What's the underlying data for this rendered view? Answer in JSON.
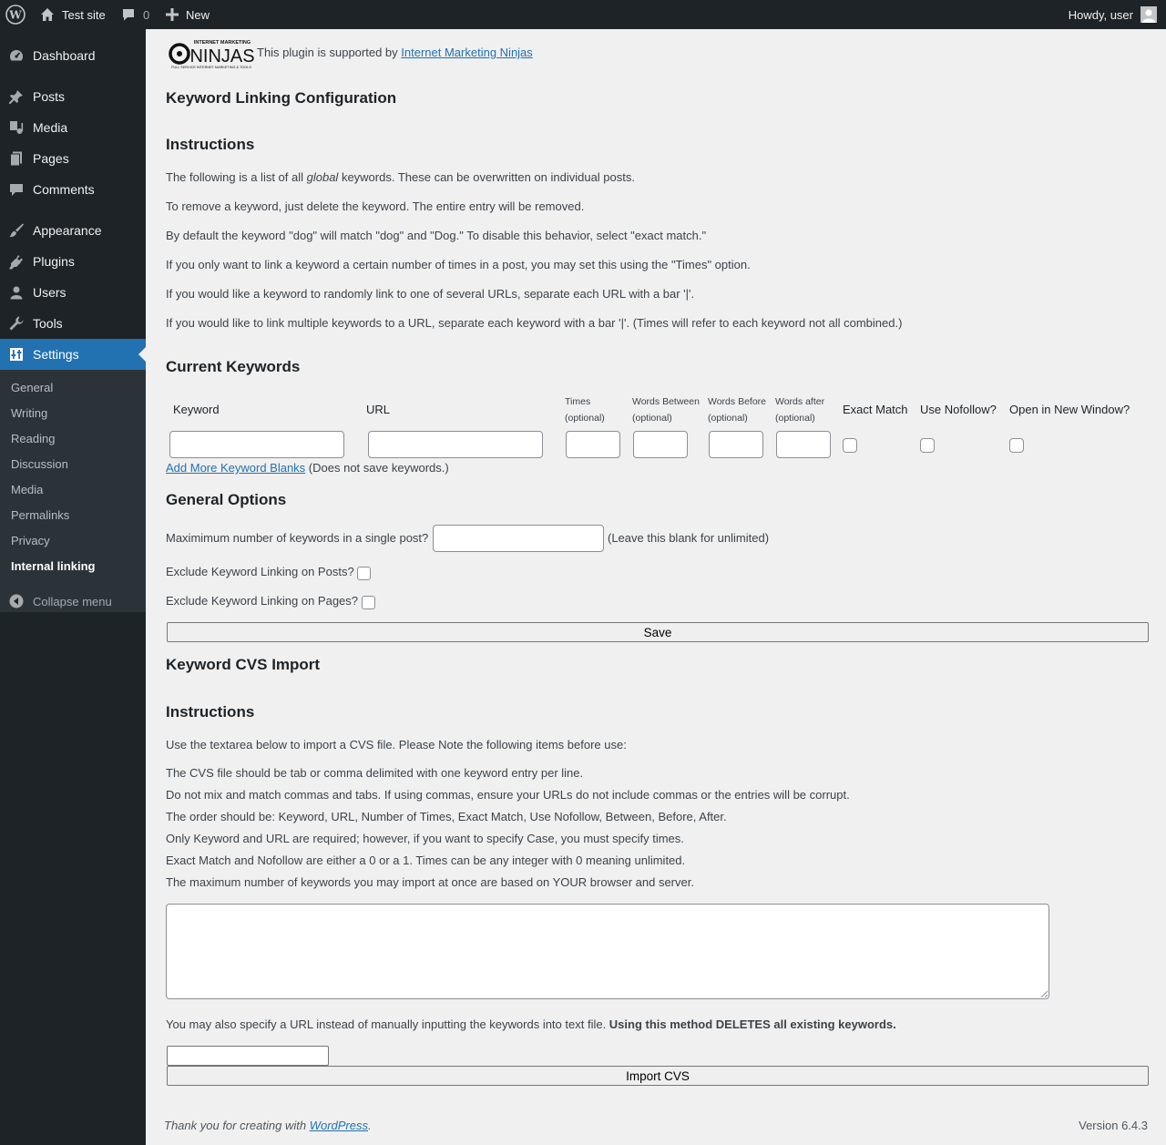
{
  "adminbar": {
    "site_name": "Test site",
    "comments_count": "0",
    "new_label": "New",
    "howdy": "Howdy, user"
  },
  "sidebar": {
    "items": [
      {
        "label": "Dashboard",
        "icon": "dashboard-icon"
      },
      {
        "label": "Posts",
        "icon": "pin-icon"
      },
      {
        "label": "Media",
        "icon": "media-icon"
      },
      {
        "label": "Pages",
        "icon": "pages-icon"
      },
      {
        "label": "Comments",
        "icon": "comments-icon"
      },
      {
        "label": "Appearance",
        "icon": "brush-icon"
      },
      {
        "label": "Plugins",
        "icon": "plug-icon"
      },
      {
        "label": "Users",
        "icon": "users-icon"
      },
      {
        "label": "Tools",
        "icon": "wrench-icon"
      },
      {
        "label": "Settings",
        "icon": "settings-icon"
      }
    ],
    "submenu": [
      "General",
      "Writing",
      "Reading",
      "Discussion",
      "Media",
      "Permalinks",
      "Privacy",
      "Internal linking"
    ],
    "collapse_label": "Collapse menu"
  },
  "sponsor": {
    "logo_top": "INTERNET MARKETING",
    "logo_main": "NINJAS",
    "logo_tag": "FULL SERVICE INTERNET MARKETING & TOOLS",
    "text": "This plugin is supported by",
    "link": "Internet Marketing Ninjas"
  },
  "page_title": "Keyword Linking Configuration",
  "instructions": {
    "heading": "Instructions",
    "line1_before": "The following is a list of all ",
    "line1_em": "global",
    "line1_after": " keywords. These can be overwritten on individual posts.",
    "lines": [
      "To remove a keyword, just delete the keyword. The entire entry will be removed.",
      "By default the keyword \"dog\" will match \"dog\" and \"Dog.\" To disable this behavior, select \"exact match.\"",
      "If you only want to link a keyword a certain number of times in a post, you may set this using the \"Times\" option.",
      "If you would like a keyword to randomly link to one of several URLs, separate each URL with a bar '|'.",
      "If you would like to link multiple keywords to a URL, separate each keyword with a bar '|'. (Times will refer to each keyword not all combined.)"
    ]
  },
  "current_keywords": {
    "heading": "Current Keywords",
    "columns": {
      "keyword": "Keyword",
      "url": "URL",
      "times": "Times",
      "words_between": "Words Between",
      "words_before": "Words Before",
      "words_after": "Words after",
      "optional": "(optional)",
      "exact_match": "Exact Match",
      "use_nofollow": "Use Nofollow?",
      "open_new_window": "Open in New Window?"
    },
    "add_more_link": "Add More Keyword Blanks",
    "add_more_note": " (Does not save keywords.)"
  },
  "general_options": {
    "heading": "General Options",
    "max_label": "Maximimum number of keywords in a single post?",
    "max_value": "",
    "max_note": "(Leave this blank for unlimited)",
    "exclude_posts": "Exclude Keyword Linking on Posts?",
    "exclude_pages": "Exclude Keyword Linking on Pages?",
    "save_label": "Save"
  },
  "import": {
    "heading": "Keyword CVS Import",
    "instructions_heading": "Instructions",
    "intro": "Use the textarea below to import a CVS file. Please Note the following items before use:",
    "notes": [
      "The CVS file should be tab or comma delimited with one keyword entry per line.",
      "Do not mix and match commas and tabs. If using commas, ensure your URLs do not include commas or the entries will be corrupt.",
      "The order should be: Keyword, URL, Number of Times, Exact Match, Use Nofollow, Between, Before, After.",
      "Only Keyword and URL are required; however, if you want to specify Case, you must specify times.",
      "Exact Match and Nofollow are either a 0 or a 1. Times can be any integer with 0 meaning unlimited.",
      "The maximum number of keywords you may import at once are based on YOUR browser and server."
    ],
    "textarea_value": "",
    "url_note": "You may also specify a URL instead of manually inputting the keywords into text file. ",
    "url_note_bold": "Using this method DELETES all existing keywords.",
    "url_value": "",
    "import_label": "Import CVS"
  },
  "footer": {
    "thanks": "Thank you for creating with ",
    "wp_link": "WordPress",
    "period": ".",
    "version": "Version 6.4.3"
  }
}
